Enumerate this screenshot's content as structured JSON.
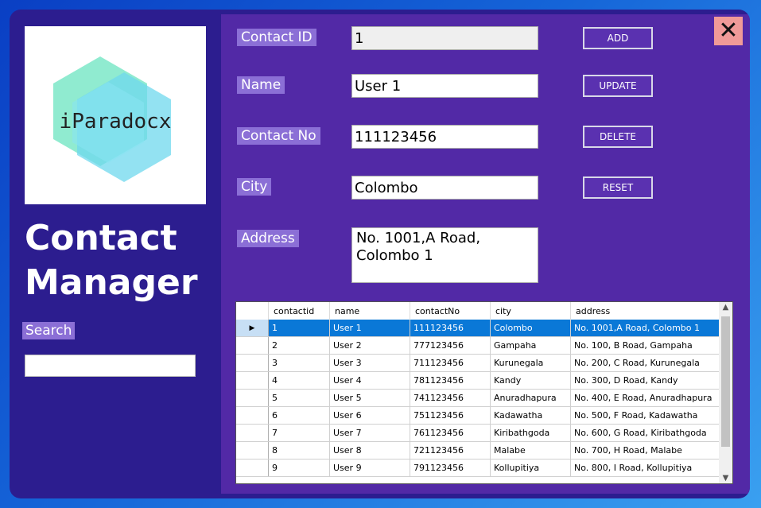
{
  "app": {
    "title_line1": "Contact",
    "title_line2": "Manager",
    "logo_text": "iParadocx",
    "close_glyph": "✕"
  },
  "search": {
    "label": "Search",
    "value": ""
  },
  "form": {
    "contact_id_label": "Contact ID",
    "contact_id_value": "1",
    "name_label": "Name",
    "name_value": "User 1",
    "contact_no_label": "Contact No",
    "contact_no_value": "111123456",
    "city_label": "City",
    "city_value": "Colombo",
    "address_label": "Address",
    "address_line1": "No. 1001,A Road,",
    "address_line2": "Colombo 1"
  },
  "buttons": {
    "add": "ADD",
    "update": "UPDATE",
    "delete": "DELETE",
    "reset": "RESET"
  },
  "grid": {
    "columns": [
      "contactid",
      "name",
      "contactNo",
      "city",
      "address"
    ],
    "selected_row": 0,
    "rows": [
      [
        "1",
        "User 1",
        "111123456",
        "Colombo",
        "No. 1001,A Road, Colombo 1"
      ],
      [
        "2",
        "User 2",
        "777123456",
        "Gampaha",
        "No. 100, B Road, Gampaha"
      ],
      [
        "3",
        "User 3",
        "711123456",
        "Kurunegala",
        "No. 200, C Road, Kurunegala"
      ],
      [
        "4",
        "User 4",
        "781123456",
        "Kandy",
        "No. 300, D Road, Kandy"
      ],
      [
        "5",
        "User 5",
        "741123456",
        "Anuradhapura",
        "No. 400, E Road, Anuradhapura"
      ],
      [
        "6",
        "User 6",
        "751123456",
        "Kadawatha",
        "No. 500, F Road, Kadawatha"
      ],
      [
        "7",
        "User 7",
        "761123456",
        "Kiribathgoda",
        "No. 600, G Road, Kiribathgoda"
      ],
      [
        "8",
        "User 8",
        "721123456",
        "Malabe",
        "No. 700, H Road, Malabe"
      ],
      [
        "9",
        "User 9",
        "791123456",
        "Kollupitiya",
        "No. 800, I Road, Kollupitiya"
      ]
    ]
  },
  "colors": {
    "window_bg": "#2c1d8f",
    "panel_bg": "#5229a6",
    "label_bg": "#8b6fd6",
    "selected_row": "#0a78d7",
    "close_bg": "#f09a98"
  }
}
